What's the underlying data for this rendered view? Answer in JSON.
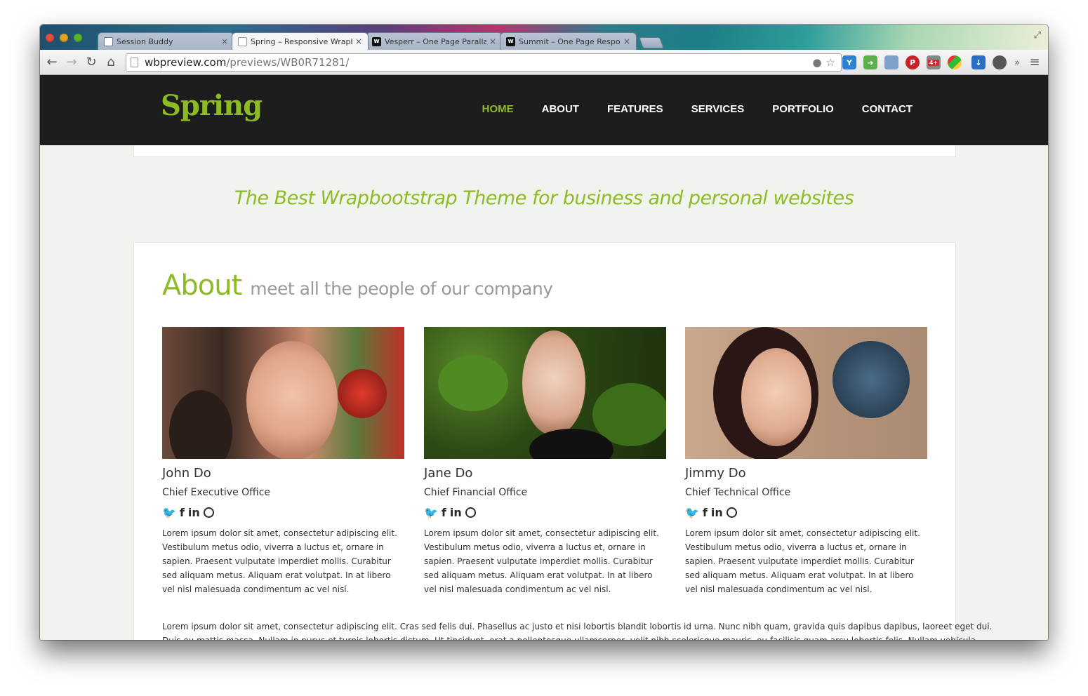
{
  "browser": {
    "tabs": [
      {
        "title": "Session Buddy",
        "favicon": "session-buddy",
        "active": false
      },
      {
        "title": "Spring – Responsive Wrapb",
        "favicon": "document",
        "active": true
      },
      {
        "title": "Vesperr – One Page Paralla",
        "favicon": "wrapbootstrap",
        "active": false
      },
      {
        "title": "Summit – One Page Respo",
        "favicon": "wrapbootstrap",
        "active": false
      }
    ],
    "close_glyph": "×",
    "url_host": "wbpreview.com",
    "url_path": "/previews/WB0R71281/",
    "extension_badge": "4+",
    "overflow_glyph": "»"
  },
  "site": {
    "logo": "Spring",
    "nav": [
      "HOME",
      "ABOUT",
      "FEATURES",
      "SERVICES",
      "PORTFOLIO",
      "CONTACT"
    ],
    "tagline": "The Best Wrapbootstrap Theme for business and personal websites",
    "about_title": "About",
    "about_subtitle": "meet all the people of our company",
    "members": [
      {
        "name": "John Do",
        "role": "Chief Executive Office",
        "bio": "Lorem ipsum dolor sit amet, consectetur adipiscing elit. Vestibulum metus odio, viverra a luctus et, ornare in sapien. Praesent vulputate imperdiet mollis. Curabitur sed aliquam metus. Aliquam erat volutpat. In at libero vel nisl malesuada condimentum ac vel nisl."
      },
      {
        "name": "Jane Do",
        "role": "Chief Financial Office",
        "bio": "Lorem ipsum dolor sit amet, consectetur adipiscing elit. Vestibulum metus odio, viverra a luctus et, ornare in sapien. Praesent vulputate imperdiet mollis. Curabitur sed aliquam metus. Aliquam erat volutpat. In at libero vel nisl malesuada condimentum ac vel nisl."
      },
      {
        "name": "Jimmy Do",
        "role": "Chief Technical Office",
        "bio": "Lorem ipsum dolor sit amet, consectetur adipiscing elit. Vestibulum metus odio, viverra a luctus et, ornare in sapien. Praesent vulputate imperdiet mollis. Curabitur sed aliquam metus. Aliquam erat volutpat. In at libero vel nisl malesuada condimentum ac vel nisl."
      }
    ],
    "social_glyphs": {
      "facebook": "f",
      "linkedin": "in"
    },
    "long_text_line1": "Lorem ipsum dolor sit amet, consectetur adipiscing elit. Cras sed felis dui. Phasellus ac justo et nisi lobortis blandit lobortis id urna. Nunc nibh quam, gravida quis dapibus dapibus, laoreet eget dui.",
    "long_text_line2": "Duis eu mattis massa. Nullam in purus et turpis lobortis dictum. Ut tincidunt, erat a pellentesque ullamcorper, velit nibh scelerisque mauris, eu facilisis quam arcu lobortis felis. Nullam vehicula"
  },
  "colors": {
    "accent": "#8dbb24",
    "header_bg": "#1d1d1d",
    "page_bg": "#f1f3ee"
  }
}
